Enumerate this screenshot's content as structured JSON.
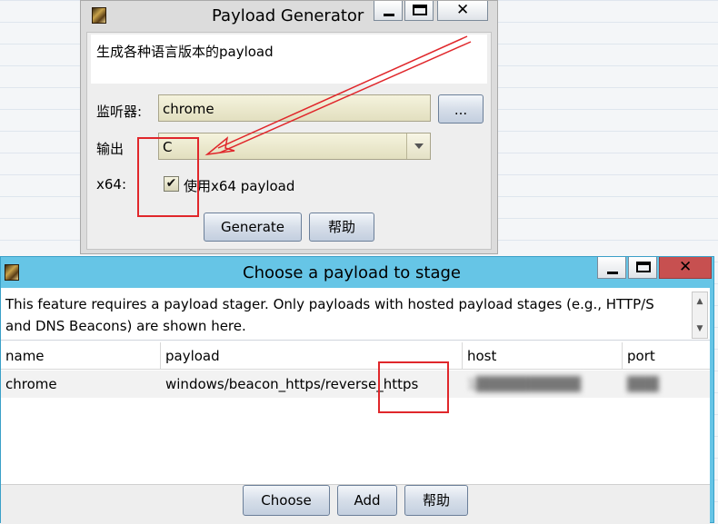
{
  "generator": {
    "title": "Payload Generator",
    "description": "生成各种语言版本的payload",
    "listener_label": "监听器:",
    "listener_value": "chrome",
    "browse_label": "...",
    "output_label": "输出",
    "output_value": "C",
    "x64_label": "x64:",
    "x64_checkbox_label": "使用x64 payload",
    "x64_checked": true,
    "generate_label": "Generate",
    "help_label": "帮助",
    "window_controls": [
      "minimize-icon",
      "maximize-icon",
      "close-icon"
    ]
  },
  "chooser": {
    "title": "Choose a payload to stage",
    "notice": "This feature requires a payload stager. Only payloads with hosted payload stages (e.g., HTTP/S and DNS Beacons) are shown here.",
    "columns": [
      "name",
      "payload",
      "host",
      "port"
    ],
    "rows": [
      {
        "name": "chrome",
        "payload": "windows/beacon_https/reverse_https",
        "host": "1██████████",
        "port": "███"
      }
    ],
    "choose_label": "Choose",
    "add_label": "Add",
    "help_label": "帮助"
  },
  "colors": {
    "chooser_titlebar": "#66c5e6",
    "close_button": "#c75050",
    "annotation_red": "#e0272b"
  }
}
